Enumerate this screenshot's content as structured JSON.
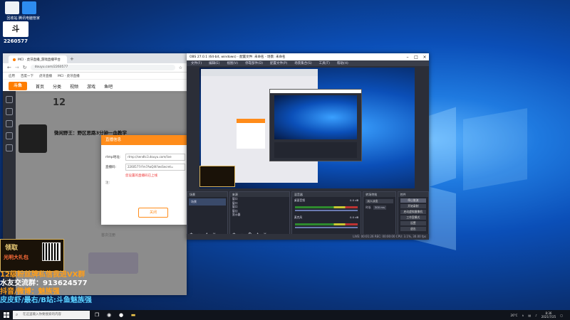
{
  "browser": {
    "tab_title": "MCI · 虎牙直播_游戏直播平台",
    "address": "douyu.com/2260577",
    "bookmarks": [
      "应用",
      "百度一下",
      "虎牙直播",
      "MCI · 虎牙直播"
    ],
    "site_logo": "斗鱼",
    "nav_items": [
      "首页",
      "分类",
      "视频",
      "游戏",
      "鱼吧"
    ],
    "side_badges": [
      "12"
    ],
    "stream_title": "微闲野王：野区思路3分钟一血教学",
    "bottom_text": "首次注册"
  },
  "dialog": {
    "title": "直播信息",
    "server_label": "rtmp地址:",
    "server_value": "rtmp://sendtc3.douyu.com/live",
    "key_label": "直播码:",
    "key_value": "2260577rFm7AaQ4t?wsSecret=",
    "warn": "您设置的直播码已上线",
    "note_label": "注:",
    "close_label": "关闭"
  },
  "obs": {
    "title": "OBS 27.0.1 (64-bit, windows) - 配置文件: 未命名 - 场景: 未命名",
    "menu": [
      "文件(F)",
      "编辑(E)",
      "视图(V)",
      "停靠部件(D)",
      "配置文件(P)",
      "场景集合(S)",
      "工具(T)",
      "帮助(H)"
    ],
    "docks": {
      "scenes": "场景",
      "sources": "来源",
      "mixer": "混音器",
      "transitions": "转场特效",
      "controls": "控件"
    },
    "scene_item": "场景",
    "source_items": [
      "窗口",
      "窗口",
      "窗口",
      "窗口",
      "显示器"
    ],
    "mixer_items": [
      {
        "name": "桌面音频",
        "db": "0.0 dB"
      },
      {
        "name": "麦克风",
        "db": "0.0 dB"
      }
    ],
    "transition_label": "淡入淡出",
    "duration_label": "时长",
    "duration_value": "300 ms",
    "control_buttons": [
      "停止推流",
      "开始录制",
      "启动虚拟摄像机",
      "工作室模式",
      "设置",
      "退出"
    ],
    "status": "LIVE: 00:01:26   REC: 00:00:00   CPU: 3.1%, 30.00 fps"
  },
  "overlay": {
    "gift_text": "领取",
    "gift_sub": "光明大礼包",
    "lines": [
      "12级粉丝牌私信我进VX群",
      "水友交流群：913624577",
      "抖音/微博：魅族强",
      "皮皮虾/最右/B站:斗鱼魅族强"
    ],
    "desktop_number": "2260577"
  },
  "desktop_icons": [
    "回收站",
    "腾讯电脑管家",
    "斗鱼"
  ],
  "taskbar": {
    "search_placeholder": "在这里输入你要搜索的内容",
    "time": "8:36",
    "date": "2021/7/25",
    "temp": "26°C"
  }
}
